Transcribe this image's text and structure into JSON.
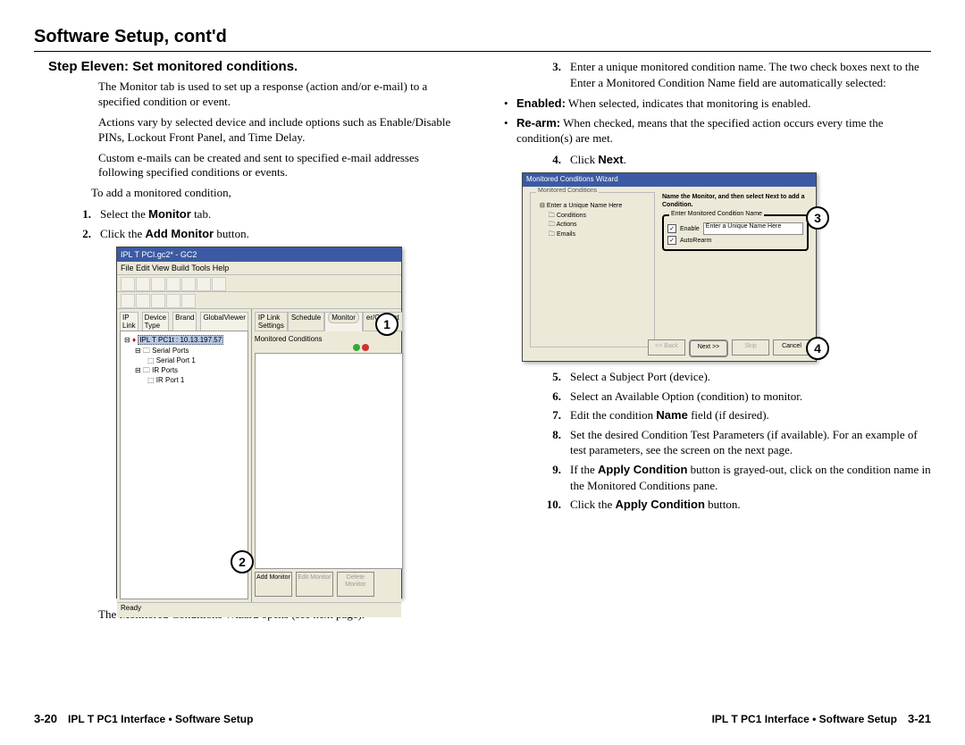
{
  "title": "Software Setup, cont'd",
  "left": {
    "step_heading": "Step Eleven: Set monitored conditions.",
    "p1": "The Monitor tab is used to set up a response (action and/or e-mail) to a specified condition or event.",
    "p2": "Actions vary by selected device and include options such as Enable/Disable PINs, Lockout Front Panel, and Time Delay.",
    "p3": "Custom e-mails can be created and sent to specified e-mail addresses following specified conditions or events.",
    "p4": "To add a monitored condition,",
    "item1_pre": "Select the ",
    "item1_bold": "Monitor",
    "item1_post": " tab.",
    "item2_pre": "Click the ",
    "item2_bold": "Add Monitor",
    "item2_post": " button.",
    "shot1": {
      "win_title": "IPL T PCI.gc2* - GC2",
      "menu": "File   Edit   View   Build   Tools   Help",
      "left_tabs": [
        "IP Link",
        "Device Type",
        "Brand",
        "GlobalViewer"
      ],
      "tree_root": "IPL T PC1t : 10.13.197.57",
      "tree_items": [
        "Serial Ports",
        "Serial Port 1",
        "IR Ports",
        "IR Port 1"
      ],
      "right_tabs": [
        "IP Link Settings",
        "Schedule",
        "Monitor",
        "er/Contact"
      ],
      "mc_label": "Monitored Conditions",
      "btn_add": "Add Monitor",
      "btn_edit": "Edit Monitor",
      "btn_del": "Delete Monitor",
      "status": "Ready"
    },
    "caption": "The Monitored Conditions Wizard opens (see next page)."
  },
  "right": {
    "item3": "Enter a unique monitored condition name.  The two check boxes next to the Enter a Monitored Condition Name field are automatically selected:",
    "bul1_bold": "Enabled:",
    "bul1_text": "  When selected, indicates that monitoring is enabled.",
    "bul2_bold": "Re-arm:",
    "bul2_text": "  When checked, means that the specified action occurs every time the condition(s) are met.",
    "item4_pre": "Click ",
    "item4_bold": "Next",
    "item4_post": ".",
    "shot2": {
      "win_title": "Monitored Conditions Wizard",
      "group_title": "Monitored Conditions",
      "tree_root": "Enter a Unique Name Here",
      "tree_items": [
        "Conditions",
        "Actions",
        "Emails"
      ],
      "instr": "Name the Monitor, and then select Next to add a Condition.",
      "field_label": "Enter Monitored Condition Name",
      "enable_label": "Enable",
      "input_value": "Enter a Unique Name Here",
      "rearm_label": "AutoRearm",
      "btn_back": "<< Back",
      "btn_next": "Next >>",
      "btn_skip": "Skip",
      "btn_cancel": "Cancel"
    },
    "item5": "Select a Subject Port (device).",
    "item6": "Select an Available Option (condition) to monitor.",
    "item7_pre": "Edit the condition ",
    "item7_bold": "Name",
    "item7_post": " field (if desired).",
    "item8": "Set the desired Condition Test Parameters (if available). For an example of test parameters, see the screen on the next page.",
    "item9_pre": "If the ",
    "item9_bold": "Apply Condition",
    "item9_post": " button is grayed-out, click on the condition name in the Monitored Conditions pane.",
    "item10_pre": "Click the ",
    "item10_bold": "Apply Condition",
    "item10_post": " button."
  },
  "footer": {
    "left_num": "3-20",
    "left_text": "IPL T PC1 Interface • Software Setup",
    "right_text": "IPL T PC1 Interface • Software Setup",
    "right_num": "3-21"
  },
  "callouts": {
    "c1": "1",
    "c2": "2",
    "c3": "3",
    "c4": "4"
  }
}
